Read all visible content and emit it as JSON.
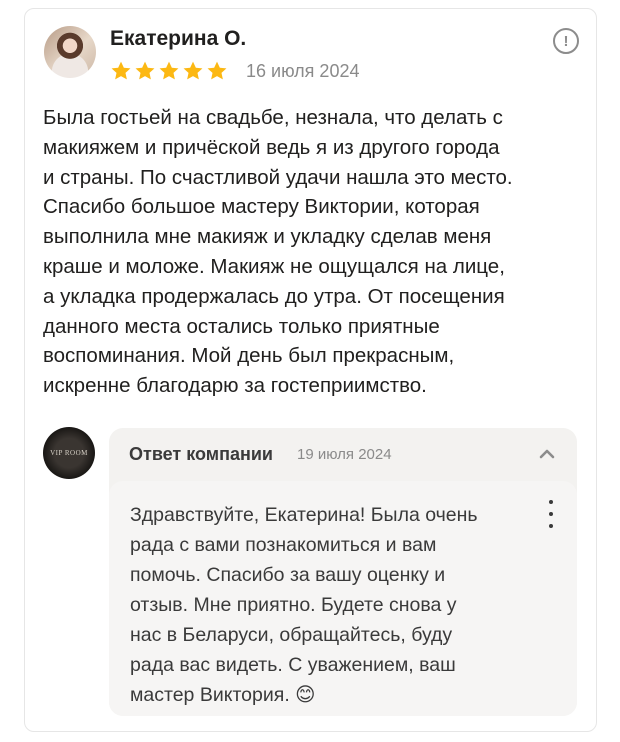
{
  "review": {
    "author": "Екатерина О.",
    "rating": 5,
    "date": "16 июля 2024",
    "text": "Была гостьей на свадьбе, незнала, что делать с\nмакияжем и причёской ведь я из другого города\nи страны. По счастливой удачи нашла это место.\nСпасибо большое мастеру Виктории, которая\nвыполнила мне макияж и укладку сделав меня\nкраше и моложе. Макияж не ощущался на лице,\nа укладка продержалась до утра. От посещения\nданного места остались только приятные\nвоспоминания. Мой день был прекрасным,\nискренне благодарю за гостеприимство.",
    "info_icon": "!"
  },
  "reply": {
    "company_avatar_text": "VIP ROOM",
    "title": "Ответ компании",
    "date": "19 июля 2024",
    "text": "Здравствуйте, Екатерина! Была очень\nрада с вами познакомиться и вам\nпомочь. Спасибо за вашу оценку и\nотзыв. Мне приятно. Будете снова у\nнас в Беларуси, обращайтесь, буду\nрада вас видеть. С уважением, ваш\nмастер Виктория. 😊"
  },
  "colors": {
    "star": "#fcb813",
    "muted": "#8a8a8a",
    "reply_bg": "#f3f2f0"
  },
  "icons": [
    "info-icon",
    "star-icon",
    "chevron-up-icon",
    "more-vertical-icon"
  ]
}
